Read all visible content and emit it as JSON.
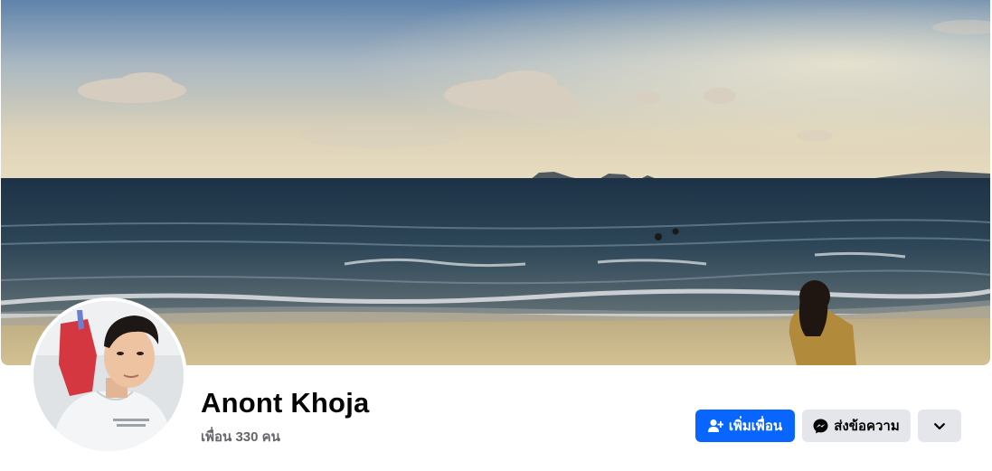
{
  "profile": {
    "name": "Anont Khoja",
    "friends_text": "เพื่อน 330 คน"
  },
  "actions": {
    "add_friend_label": "เพิ่มเพื่อน",
    "message_label": "ส่งข้อความ",
    "more_icon": "chevron-down-icon"
  },
  "colors": {
    "primary": "#0866ff",
    "secondary_button": "#e4e6eb",
    "text_primary": "#050505",
    "text_secondary": "#65676b"
  }
}
